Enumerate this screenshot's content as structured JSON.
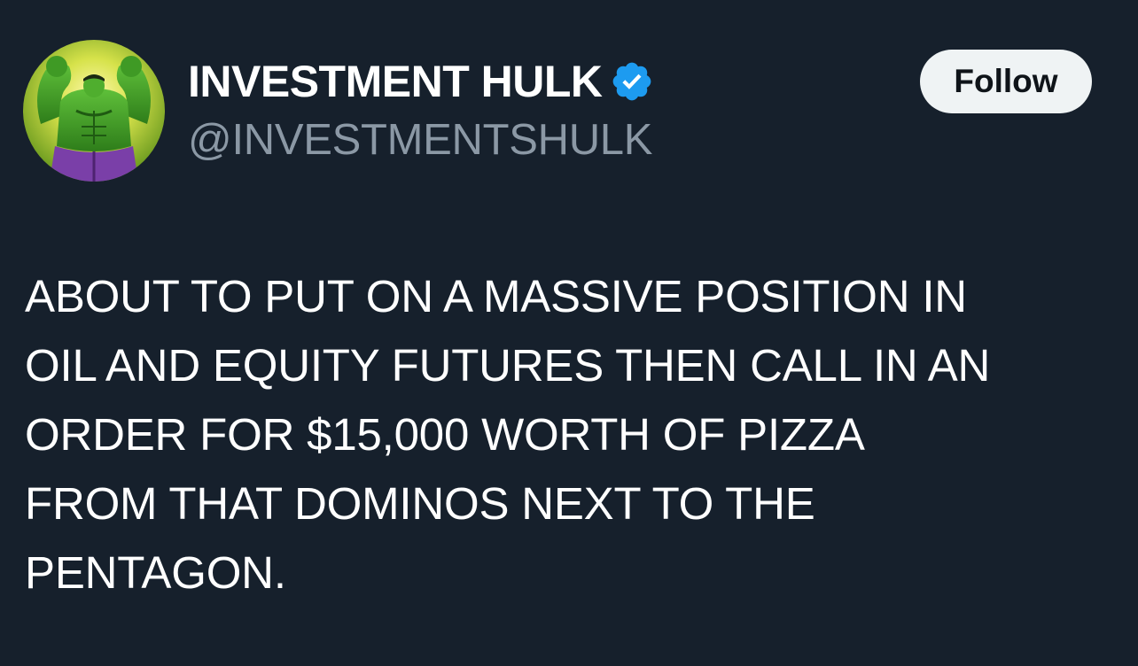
{
  "account": {
    "display_name": "INVESTMENT HULK",
    "handle": "@INVESTMENTSHULK",
    "verified": true,
    "avatar_icon": "hulk-avatar",
    "verified_icon": "verified-badge-icon",
    "verified_color": "#1d9bf0"
  },
  "actions": {
    "follow_label": "Follow"
  },
  "tweet": {
    "lines": [
      "ABOUT TO PUT ON A MASSIVE POSITION IN",
      "OIL AND EQUITY FUTURES THEN CALL IN AN",
      "ORDER FOR $15,000 WORTH OF PIZZA",
      "FROM THAT DOMINOS NEXT TO THE",
      "PENTAGON."
    ]
  },
  "colors": {
    "background": "#16202c",
    "text": "#ffffff",
    "handle": "#8b98a5",
    "button_bg": "#eff3f4",
    "button_text": "#0f1419"
  }
}
